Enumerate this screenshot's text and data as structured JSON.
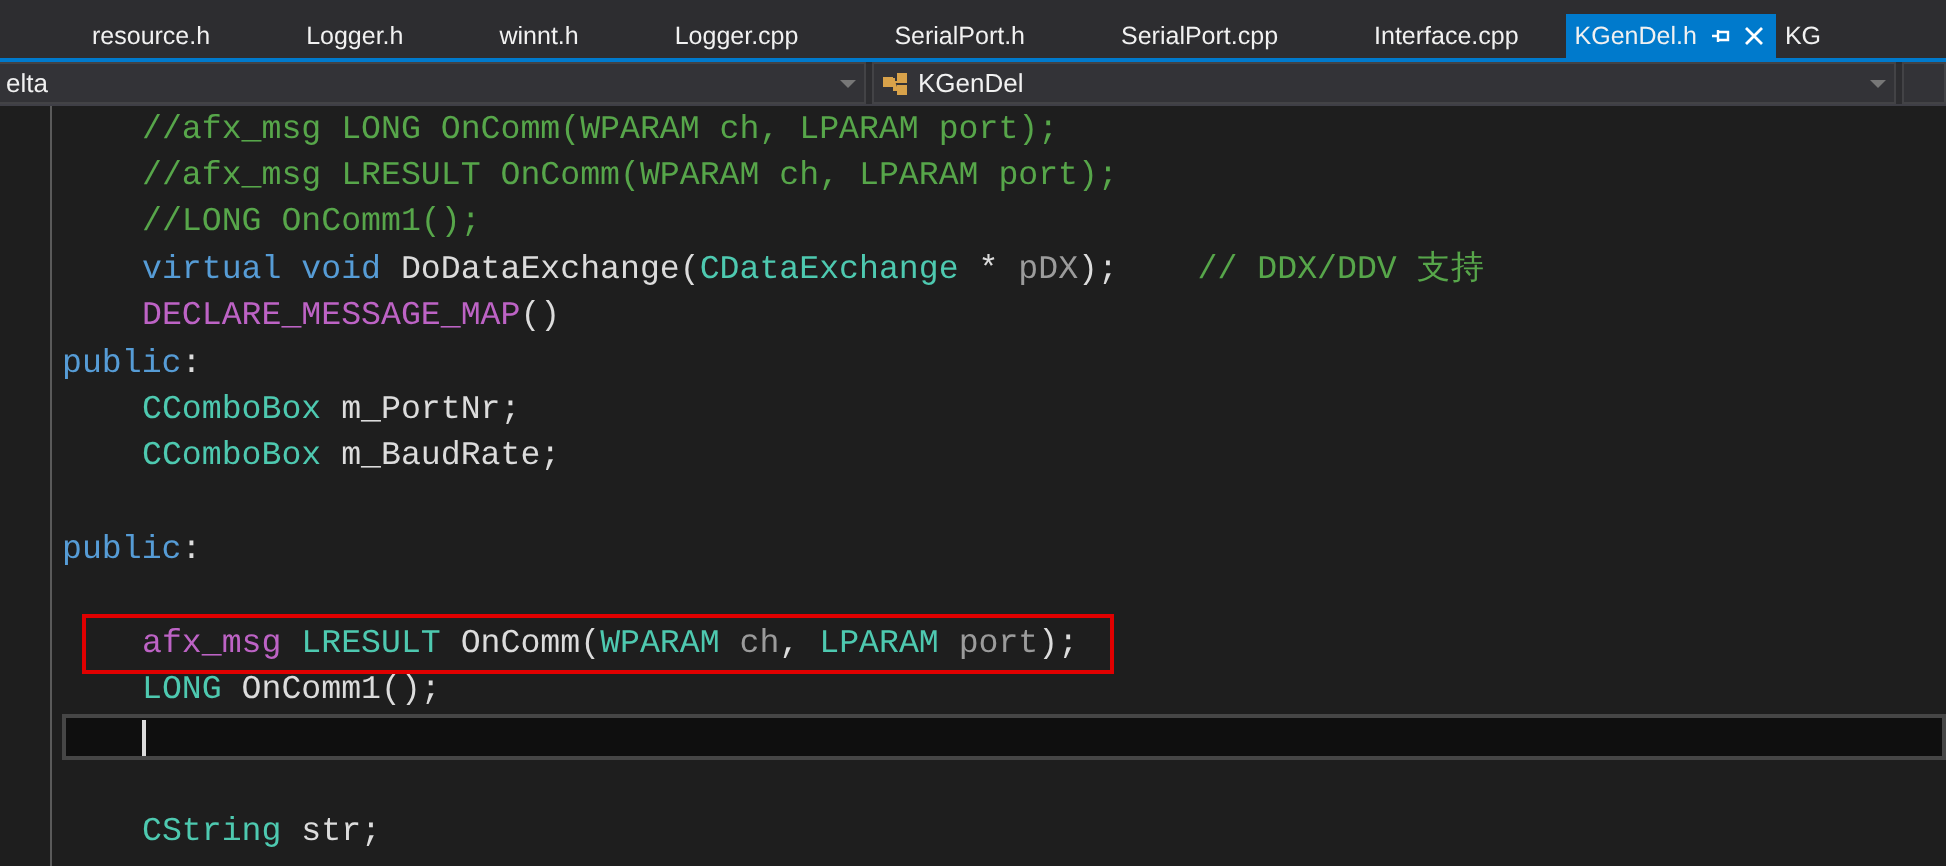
{
  "tabs": [
    {
      "label": "resource.h",
      "selected": false
    },
    {
      "label": "Logger.h",
      "selected": false
    },
    {
      "label": "winnt.h",
      "selected": false
    },
    {
      "label": "Logger.cpp",
      "selected": false
    },
    {
      "label": "SerialPort.h",
      "selected": false
    },
    {
      "label": "SerialPort.cpp",
      "selected": false
    },
    {
      "label": "Interface.cpp",
      "selected": false
    },
    {
      "label": "KGenDel.h",
      "selected": true
    },
    {
      "label": "KG",
      "selected": false
    }
  ],
  "navigation_bar": {
    "project_dropdown": "elta",
    "class_dropdown": "KGenDel"
  },
  "code_lines": [
    {
      "kind": "code",
      "indented": true,
      "current": false,
      "highlighted": false,
      "tokens": [
        {
          "kind": "comment",
          "text": "//afx_msg LONG OnComm(WPARAM ch, LPARAM port);"
        }
      ]
    },
    {
      "kind": "code",
      "indented": true,
      "current": false,
      "highlighted": false,
      "tokens": [
        {
          "kind": "comment",
          "text": "//afx_msg LRESULT OnComm(WPARAM ch, LPARAM port);"
        }
      ]
    },
    {
      "kind": "code",
      "indented": true,
      "current": false,
      "highlighted": false,
      "tokens": [
        {
          "kind": "comment",
          "text": "//LONG OnComm1();"
        }
      ]
    },
    {
      "kind": "code",
      "indented": true,
      "current": false,
      "highlighted": false,
      "tokens": [
        {
          "kind": "keyword",
          "text": "virtual"
        },
        {
          "kind": "keyword",
          "text": "void"
        },
        {
          "kind": "plain",
          "text": "DoDataExchange("
        },
        {
          "kind": "type",
          "text": "CDataExchange"
        },
        {
          "kind": "plain",
          "text": "*"
        },
        {
          "kind": "param",
          "text": "pDX"
        },
        {
          "kind": "plain",
          "text": ");"
        },
        {
          "kind": "comment",
          "text": "    // DDX/DDV 支持"
        }
      ]
    },
    {
      "kind": "code",
      "indented": true,
      "current": false,
      "highlighted": false,
      "tokens": [
        {
          "kind": "macro",
          "text": "DECLARE_MESSAGE_MAP"
        },
        {
          "kind": "plain",
          "text": "()"
        }
      ]
    },
    {
      "kind": "code",
      "indented": false,
      "current": false,
      "highlighted": false,
      "tokens": [
        {
          "kind": "keyword",
          "text": "public"
        },
        {
          "kind": "plain",
          "text": ":"
        }
      ]
    },
    {
      "kind": "code",
      "indented": true,
      "current": false,
      "highlighted": false,
      "tokens": [
        {
          "kind": "type",
          "text": "CComboBox"
        },
        {
          "kind": "plain",
          "text": "m_PortNr;"
        }
      ]
    },
    {
      "kind": "code",
      "indented": true,
      "current": false,
      "highlighted": false,
      "tokens": [
        {
          "kind": "type",
          "text": "CComboBox"
        },
        {
          "kind": "plain",
          "text": "m_BaudRate;"
        }
      ]
    },
    {
      "kind": "blank",
      "current": false
    },
    {
      "kind": "code",
      "indented": false,
      "current": false,
      "highlighted": false,
      "tokens": [
        {
          "kind": "keyword",
          "text": "public"
        },
        {
          "kind": "plain",
          "text": ":"
        }
      ]
    },
    {
      "kind": "blank",
      "current": false
    },
    {
      "kind": "code",
      "indented": true,
      "current": false,
      "highlighted": true,
      "tokens": [
        {
          "kind": "macro",
          "text": "afx_msg"
        },
        {
          "kind": "type",
          "text": "LRESULT"
        },
        {
          "kind": "plain",
          "text": "OnComm("
        },
        {
          "kind": "type",
          "text": "WPARAM"
        },
        {
          "kind": "param",
          "text": "ch"
        },
        {
          "kind": "plain",
          "text": ","
        },
        {
          "kind": "type",
          "text": "LPARAM"
        },
        {
          "kind": "param",
          "text": "port"
        },
        {
          "kind": "plain",
          "text": ");"
        }
      ]
    },
    {
      "kind": "code",
      "indented": true,
      "current": false,
      "highlighted": false,
      "tokens": [
        {
          "kind": "type",
          "text": "LONG"
        },
        {
          "kind": "plain",
          "text": "OnComm1();"
        }
      ]
    },
    {
      "kind": "blank",
      "current": true
    },
    {
      "kind": "blank",
      "current": false
    },
    {
      "kind": "code",
      "indented": true,
      "current": false,
      "highlighted": false,
      "tokens": [
        {
          "kind": "type",
          "text": "CString"
        },
        {
          "kind": "plain",
          "text": "str;"
        }
      ]
    }
  ]
}
